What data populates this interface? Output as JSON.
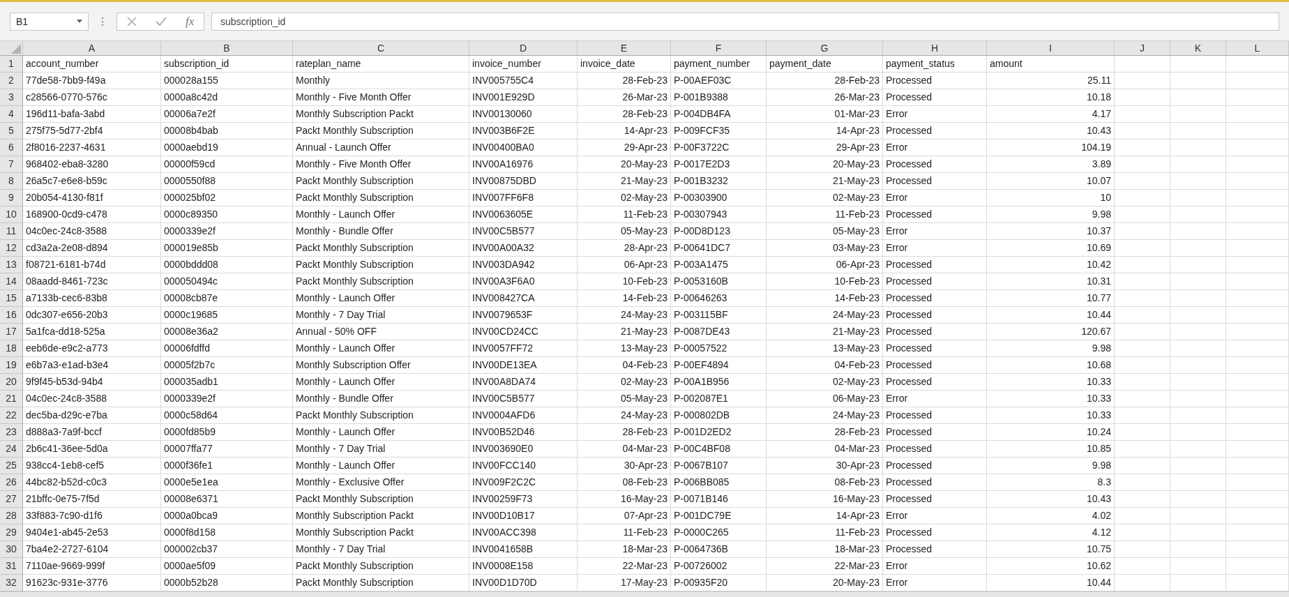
{
  "formula_bar": {
    "name_box": "B1",
    "function_label": "fx",
    "formula": "subscription_id"
  },
  "columns": [
    {
      "letter": "A",
      "kind": "text"
    },
    {
      "letter": "B",
      "kind": "text"
    },
    {
      "letter": "C",
      "kind": "text"
    },
    {
      "letter": "D",
      "kind": "text"
    },
    {
      "letter": "E",
      "kind": "date"
    },
    {
      "letter": "F",
      "kind": "text"
    },
    {
      "letter": "G",
      "kind": "date"
    },
    {
      "letter": "H",
      "kind": "text"
    },
    {
      "letter": "I",
      "kind": "number"
    },
    {
      "letter": "J"
    },
    {
      "letter": "K"
    },
    {
      "letter": "L"
    }
  ],
  "header_row": {
    "number": "1",
    "cells": [
      "account_number",
      "subscription_id",
      "rateplan_name",
      "invoice_number",
      "invoice_date",
      "payment_number",
      "payment_date",
      "payment_status",
      "amount"
    ]
  },
  "rows": [
    {
      "number": "2",
      "cells": [
        "77de58-7bb9-f49a",
        "000028a155",
        "Monthly",
        "INV005755C4",
        "28-Feb-23",
        "P-00AEF03C",
        "28-Feb-23",
        "Processed",
        "25.11"
      ]
    },
    {
      "number": "3",
      "cells": [
        "c28566-0770-576c",
        "0000a8c42d",
        "Monthly - Five Month Offer",
        "INV001E929D",
        "26-Mar-23",
        "P-001B9388",
        "26-Mar-23",
        "Processed",
        "10.18"
      ]
    },
    {
      "number": "4",
      "cells": [
        "196d11-bafa-3abd",
        "00006a7e2f",
        "Monthly Subscription Packt",
        "INV00130060",
        "28-Feb-23",
        "P-004DB4FA",
        "01-Mar-23",
        "Error",
        "4.17"
      ]
    },
    {
      "number": "5",
      "cells": [
        "275f75-5d77-2bf4",
        "00008b4bab",
        "Packt Monthly Subscription",
        "INV003B6F2E",
        "14-Apr-23",
        "P-009FCF35",
        "14-Apr-23",
        "Processed",
        "10.43"
      ]
    },
    {
      "number": "6",
      "cells": [
        "2f8016-2237-4631",
        "0000aebd19",
        "Annual - Launch Offer",
        "INV00400BA0",
        "29-Apr-23",
        "P-00F3722C",
        "29-Apr-23",
        "Error",
        "104.19"
      ]
    },
    {
      "number": "7",
      "cells": [
        "968402-eba8-3280",
        "00000f59cd",
        "Monthly - Five Month Offer",
        "INV00A16976",
        "20-May-23",
        "P-0017E2D3",
        "20-May-23",
        "Processed",
        "3.89"
      ]
    },
    {
      "number": "8",
      "cells": [
        "26a5c7-e6e8-b59c",
        "0000550f88",
        "Packt Monthly Subscription",
        "INV00875DBD",
        "21-May-23",
        "P-001B3232",
        "21-May-23",
        "Processed",
        "10.07"
      ]
    },
    {
      "number": "9",
      "cells": [
        "20b054-4130-f81f",
        "000025bf02",
        "Packt Monthly Subscription",
        "INV007FF6F8",
        "02-May-23",
        "P-00303900",
        "02-May-23",
        "Error",
        "10"
      ]
    },
    {
      "number": "10",
      "cells": [
        "168900-0cd9-c478",
        "0000c89350",
        "Monthly - Launch Offer",
        "INV0063605E",
        "11-Feb-23",
        "P-00307943",
        "11-Feb-23",
        "Processed",
        "9.98"
      ]
    },
    {
      "number": "11",
      "cells": [
        "04c0ec-24c8-3588",
        "0000339e2f",
        "Monthly - Bundle Offer",
        "INV00C5B577",
        "05-May-23",
        "P-00D8D123",
        "05-May-23",
        "Error",
        "10.37"
      ]
    },
    {
      "number": "12",
      "cells": [
        "cd3a2a-2e08-d894",
        "000019e85b",
        "Packt Monthly Subscription",
        "INV00A00A32",
        "28-Apr-23",
        "P-00641DC7",
        "03-May-23",
        "Error",
        "10.69"
      ]
    },
    {
      "number": "13",
      "cells": [
        "f08721-6181-b74d",
        "0000bddd08",
        "Packt Monthly Subscription",
        "INV003DA942",
        "06-Apr-23",
        "P-003A1475",
        "06-Apr-23",
        "Processed",
        "10.42"
      ]
    },
    {
      "number": "14",
      "cells": [
        "08aadd-8461-723c",
        "000050494c",
        "Packt Monthly Subscription",
        "INV00A3F6A0",
        "10-Feb-23",
        "P-0053160B",
        "10-Feb-23",
        "Processed",
        "10.31"
      ]
    },
    {
      "number": "15",
      "cells": [
        "a7133b-cec6-83b8",
        "00008cb87e",
        "Monthly - Launch Offer",
        "INV008427CA",
        "14-Feb-23",
        "P-00646263",
        "14-Feb-23",
        "Processed",
        "10.77"
      ]
    },
    {
      "number": "16",
      "cells": [
        "0dc307-e656-20b3",
        "0000c19685",
        "Monthly - 7 Day Trial",
        "INV0079653F",
        "24-May-23",
        "P-003115BF",
        "24-May-23",
        "Processed",
        "10.44"
      ]
    },
    {
      "number": "17",
      "cells": [
        "5a1fca-dd18-525a",
        "00008e36a2",
        "Annual - 50% OFF",
        "INV00CD24CC",
        "21-May-23",
        "P-0087DE43",
        "21-May-23",
        "Processed",
        "120.67"
      ]
    },
    {
      "number": "18",
      "cells": [
        "eeb6de-e9c2-a773",
        "00006fdffd",
        "Monthly - Launch Offer",
        "INV0057FF72",
        "13-May-23",
        "P-00057522",
        "13-May-23",
        "Processed",
        "9.98"
      ]
    },
    {
      "number": "19",
      "cells": [
        "e6b7a3-e1ad-b3e4",
        "00005f2b7c",
        "Monthly Subscription Offer",
        "INV00DE13EA",
        "04-Feb-23",
        "P-00EF4894",
        "04-Feb-23",
        "Processed",
        "10.68"
      ]
    },
    {
      "number": "20",
      "cells": [
        "9f9f45-b53d-94b4",
        "000035adb1",
        "Monthly - Launch Offer",
        "INV00A8DA74",
        "02-May-23",
        "P-00A1B956",
        "02-May-23",
        "Processed",
        "10.33"
      ]
    },
    {
      "number": "21",
      "cells": [
        "04c0ec-24c8-3588",
        "0000339e2f",
        "Monthly - Bundle Offer",
        "INV00C5B577",
        "05-May-23",
        "P-002087E1",
        "06-May-23",
        "Error",
        "10.33"
      ]
    },
    {
      "number": "22",
      "cells": [
        "dec5ba-d29c-e7ba",
        "0000c58d64",
        "Packt Monthly Subscription",
        "INV0004AFD6",
        "24-May-23",
        "P-000802DB",
        "24-May-23",
        "Processed",
        "10.33"
      ]
    },
    {
      "number": "23",
      "cells": [
        "d888a3-7a9f-bccf",
        "0000fd85b9",
        "Monthly - Launch Offer",
        "INV00B52D46",
        "28-Feb-23",
        "P-001D2ED2",
        "28-Feb-23",
        "Processed",
        "10.24"
      ]
    },
    {
      "number": "24",
      "cells": [
        "2b6c41-36ee-5d0a",
        "00007ffa77",
        "Monthly - 7 Day Trial",
        "INV003690E0",
        "04-Mar-23",
        "P-00C4BF08",
        "04-Mar-23",
        "Processed",
        "10.85"
      ]
    },
    {
      "number": "25",
      "cells": [
        "938cc4-1eb8-cef5",
        "0000f36fe1",
        "Monthly - Launch Offer",
        "INV00FCC140",
        "30-Apr-23",
        "P-0067B107",
        "30-Apr-23",
        "Processed",
        "9.98"
      ]
    },
    {
      "number": "26",
      "cells": [
        "44bc82-b52d-c0c3",
        "0000e5e1ea",
        "Monthly - Exclusive Offer",
        "INV009F2C2C",
        "08-Feb-23",
        "P-006BB085",
        "08-Feb-23",
        "Processed",
        "8.3"
      ]
    },
    {
      "number": "27",
      "cells": [
        "21bffc-0e75-7f5d",
        "00008e6371",
        "Packt Monthly Subscription",
        "INV00259F73",
        "16-May-23",
        "P-0071B146",
        "16-May-23",
        "Processed",
        "10.43"
      ]
    },
    {
      "number": "28",
      "cells": [
        "33f883-7c90-d1f6",
        "0000a0bca9",
        "Monthly Subscription Packt",
        "INV00D10B17",
        "07-Apr-23",
        "P-001DC79E",
        "14-Apr-23",
        "Error",
        "4.02"
      ]
    },
    {
      "number": "29",
      "cells": [
        "9404e1-ab45-2e53",
        "0000f8d158",
        "Monthly Subscription Packt",
        "INV00ACC398",
        "11-Feb-23",
        "P-0000C265",
        "11-Feb-23",
        "Processed",
        "4.12"
      ]
    },
    {
      "number": "30",
      "cells": [
        "7ba4e2-2727-6104",
        "000002cb37",
        "Monthly - 7 Day Trial",
        "INV0041658B",
        "18-Mar-23",
        "P-0064736B",
        "18-Mar-23",
        "Processed",
        "10.75"
      ]
    },
    {
      "number": "31",
      "cells": [
        "7110ae-9669-999f",
        "0000ae5f09",
        "Packt Monthly Subscription",
        "INV0008E158",
        "22-Mar-23",
        "P-00726002",
        "22-Mar-23",
        "Error",
        "10.62"
      ]
    },
    {
      "number": "32",
      "cells": [
        "91623c-931e-3776",
        "0000b52b28",
        "Packt Monthly Subscription",
        "INV00D1D70D",
        "17-May-23",
        "P-00935F20",
        "20-May-23",
        "Error",
        "10.44"
      ]
    }
  ]
}
